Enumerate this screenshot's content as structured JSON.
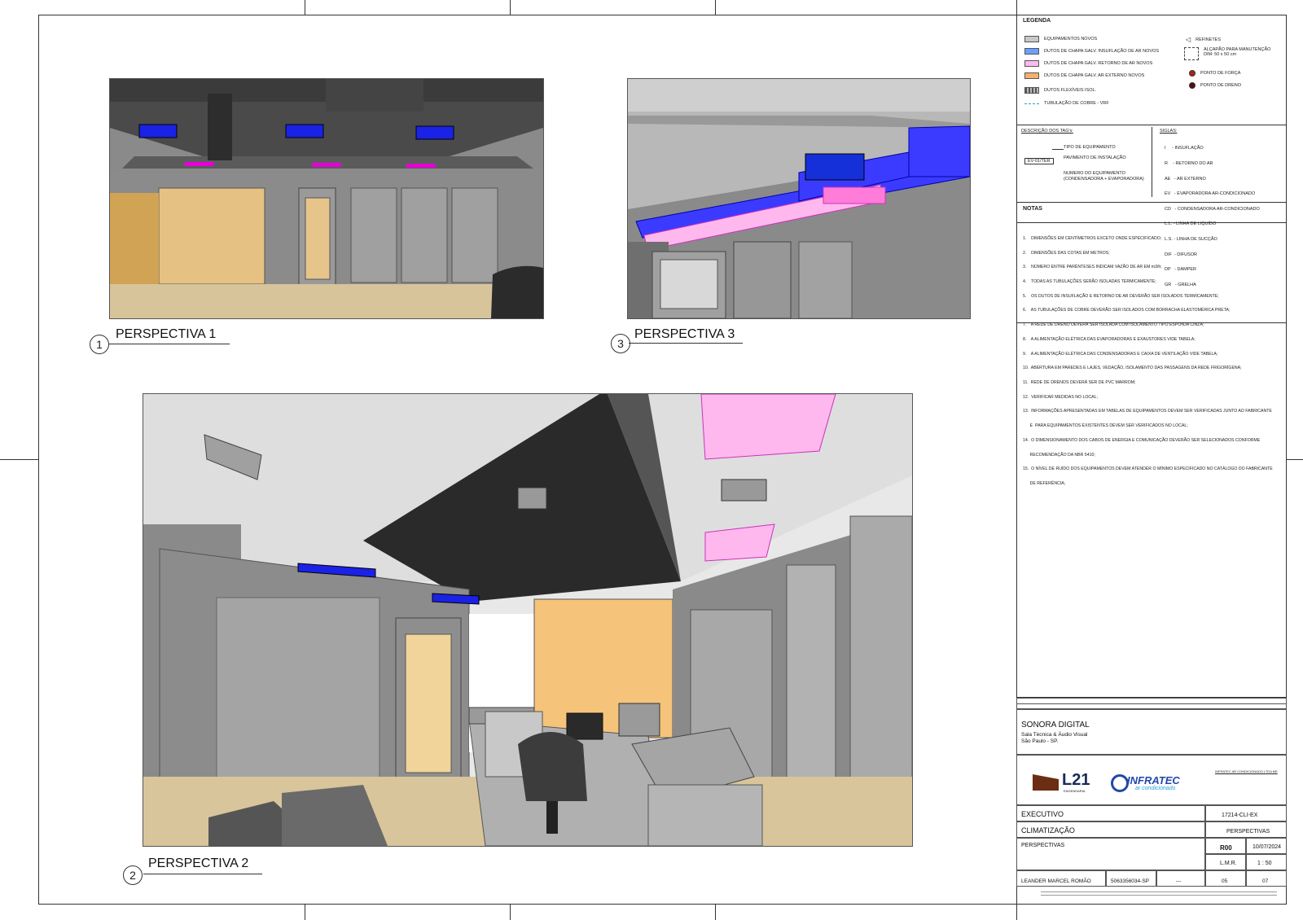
{
  "views": [
    {
      "number": "1",
      "title": "PERSPECTIVA 1"
    },
    {
      "number": "3",
      "title": "PERSPECTIVA 3"
    },
    {
      "number": "2",
      "title": "PERSPECTIVA 2"
    }
  ],
  "legend": {
    "heading": "LEGENDA",
    "items_left": [
      {
        "label": "EQUIPAMENTOS NOVOS",
        "color": "#c8c8c8"
      },
      {
        "label": "DUTOS DE CHAPA GALV. INSUFLAÇÃO DE AR NOVOS",
        "color": "#6aa0ff"
      },
      {
        "label": "DUTOS DE CHAPA GALV. RETORNO DE AR NOVOS",
        "color": "#ffb8f0"
      },
      {
        "label": "DUTOS DE CHAPA GALV. AR EXTERNO NOVOS",
        "color": "#f5b070"
      },
      {
        "label": "DUTOS FLEXÍVEIS ISOL.",
        "color": "#9a9a9a"
      },
      {
        "label": "TUBULAÇÃO DE  COBRE - VRF",
        "color": "#22aa99"
      }
    ],
    "items_right": [
      {
        "label": "REFINETES"
      },
      {
        "label": "ALÇAPÃO PARA MANUTENÇÃO",
        "sub": "DIM: 50 x 50 cm"
      },
      {
        "label": "PONTO DE FORÇA"
      },
      {
        "label": "PONTO DE DRENO"
      }
    ]
  },
  "tags": {
    "heading": "DESCRIÇÃO DOS TAG's:",
    "tag_code": "EV-01/TER",
    "lines": [
      "TIPO DE EQUIPAMENTO",
      "PAVIMENTO DE INSTALAÇÃO",
      "NUMERO DO EQUIPAMENTO",
      "(CONDENSADORA + EVAPORADORA)"
    ]
  },
  "siglas": {
    "heading": "SIGLAS:",
    "items": [
      "I     - INSUFLAÇÃO",
      "R    - RETORNO DO AR",
      "AE   - AR EXTERNO",
      "EV   - EVAPORADORA AR-CONDICIONADO",
      "CD   - CONDENSADORA AR-CONDICIONADO",
      "L.L. - LINHA DE LIQUÍDO",
      "L.S. - LINHA DE SUCÇÃO",
      "DIF  - DIFUSOR",
      "DP   - DAMPER",
      "GR   - GRELHA"
    ]
  },
  "notes": {
    "heading": "NOTAS",
    "items": [
      "1.    DIMENSÕES EM CENTÍMETROS EXCETO ONDE ESPECIFICADO;",
      "2.    DIMENSÕES DAS COTAS EM METROS;",
      "3.    NÚMERO ENTRE PARÊNTESES INDICAM VAZÃO DE AR EM m3/h;",
      "4.    TODAS AS TUBULAÇÕES SERÃO ISOLADAS TERMICAMENTE;",
      "5.    OS DUTOS DE INSUFLAÇÃO E RETORNO DE AR DEVERÃO SER ISOLADOS TERMICAMENTE;",
      "6.    AS TUBULAÇÕES DE COBRE DEVERÃO SER ISOLADOS COM BORRACHA ELASTOMÉRICA PRETA;",
      "7.    A REDE DE DRENO DEVERÁ SER ISOLADA COM ISOLAMENTO TIPO ESPONJA CINZA;",
      "8.    A ALIMENTAÇÃO ELÉTRICA DAS EVAPORADORAS E EXAUSTORES VIDE TABELA;",
      "9.    A ALIMENTAÇÃO ELÉTRICA DAS CONDENSADORAS E CAIXA DE VENTILAÇÃO VIDE TABELA;",
      "10.  ABERTURA EM PAREDES E LAJES, VEDAÇÃO, ISOLAMENTO DAS PASSAGENS DA REDE FRIGORÍGENA;",
      "11.  REDE DE DRENOS DEVERÁ SER DE PVC MARROM;",
      "12.  VERIFICAR MEDIDAS NO LOCAL;",
      "13.  INFORMAÇÕES APRESENTADAS EM TABELAS DE EQUIPAMENTOS DEVEM SER VERIFICADAS JUNTO AO FABRICANTE",
      "      E  PARA EQUIPAMENTOS EXISTENTES DEVEM SER VERIFICADOS NO LOCAL;",
      "14.  O DIMENSIONAMENTO DOS CABOS DE ENERGIA E COMUNICAÇÃO DEVERÃO SER SELECIONADOS CONFORME",
      "      RECOMENDAÇÃO DA NBR 5410;",
      "15.  O NÍVEL DE RUÍDO DOS EQUIPAMENTOS DEVEM ATENDER O MÍNIMO ESPECIFICADO NO CATÁLOGO DO FABRICANTE",
      "      DE REFERÊNCIA;"
    ]
  },
  "title_block": {
    "client": "SONORA DIGITAL",
    "client_sub1": "Sala Técnica & Áudio Visual",
    "client_sub2": "São Paulo - SP.",
    "company1": "L21",
    "company1_sub": "ENGENHARIA",
    "company2": "INFRATEC",
    "company2_sub": "ar condicionado",
    "company2_name": "INFRATEC AR CONDICIONADO LTDA ME",
    "stage": "EXECUTIVO",
    "file_name": "17214-CLI-EX",
    "discipline": "CLIMATIZAÇÃO",
    "board_type": "PERSPECTIVAS",
    "sheet_title": "PERSPECTIVAS",
    "revision": "R00",
    "date": "10/07/2024",
    "drawn_by": "L.M.R.",
    "scale": "1 : 50",
    "responsible": "LEANDER MARCEL ROMÃO",
    "crea": "5063356034-SP",
    "art": "---",
    "sheet_no": "05",
    "total_sheets": "07"
  }
}
